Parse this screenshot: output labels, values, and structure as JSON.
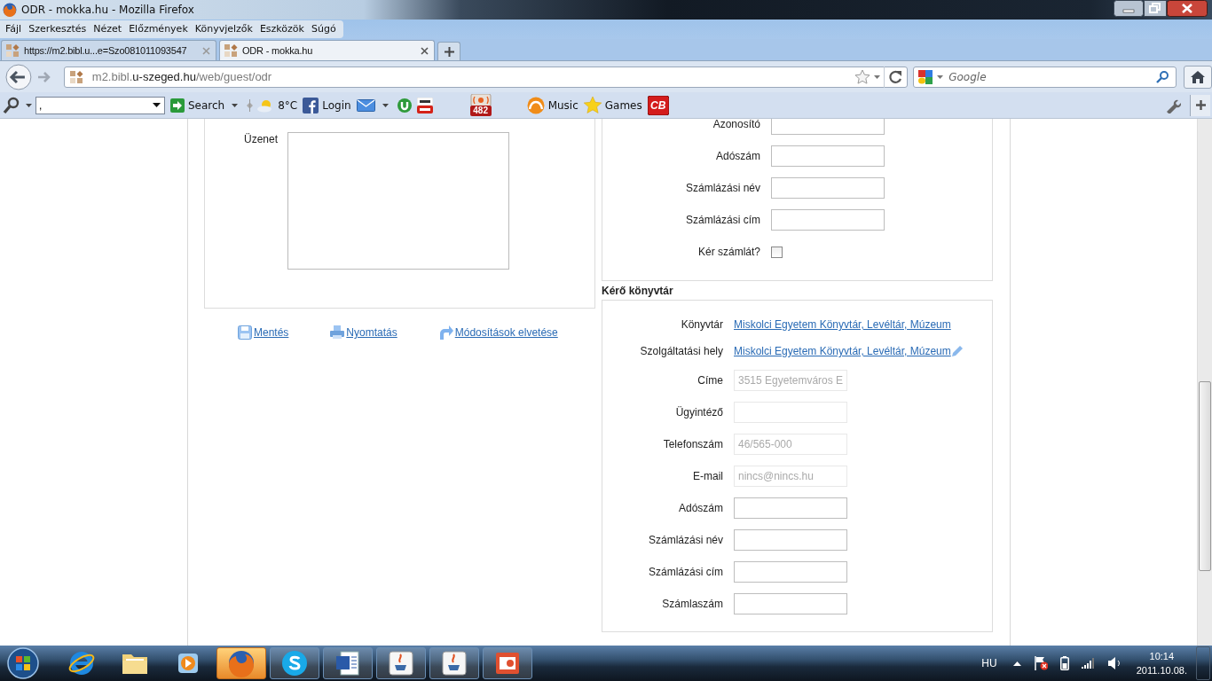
{
  "window": {
    "title": "ODR - mokka.hu - Mozilla Firefox"
  },
  "menu": [
    "Fájl",
    "Szerkesztés",
    "Nézet",
    "Előzmények",
    "Könyvjelzők",
    "Eszközök",
    "Súgó"
  ],
  "tabs": [
    {
      "label": "https://m2.bibl.u...e=Szo081011093547",
      "selected": false
    },
    {
      "label": "ODR - mokka.hu",
      "selected": true
    }
  ],
  "address": {
    "prefix": "m2.bibl.",
    "domain": "u-szeged.hu",
    "path": "/web/guest/odr"
  },
  "search": {
    "placeholder": "Google"
  },
  "bookmarks": {
    "search_value": ",",
    "items": [
      {
        "kind": "go",
        "label": "Search"
      },
      {
        "kind": "weather",
        "label": "8°C"
      },
      {
        "kind": "facebook",
        "label": "Login"
      },
      {
        "kind": "mail"
      },
      {
        "kind": "torrent"
      },
      {
        "kind": "youtube"
      },
      {
        "kind": "counter",
        "badge": "482"
      },
      {
        "kind": "music",
        "label": "Music"
      },
      {
        "kind": "games",
        "label": "Games"
      },
      {
        "kind": "cb",
        "badge": "CB"
      }
    ]
  },
  "message": {
    "label": "Üzenet"
  },
  "actions": [
    {
      "kind": "save",
      "label": "Mentés"
    },
    {
      "kind": "print",
      "label": "Nyomtatás"
    },
    {
      "kind": "undo",
      "label": "Módosítások elvetése"
    }
  ],
  "billing": {
    "fields": [
      {
        "label": "Azonosító",
        "disabled": false
      },
      {
        "label": "Adószám",
        "disabled": false
      },
      {
        "label": "Számlázási név",
        "disabled": false
      },
      {
        "label": "Számlázási cím",
        "disabled": false
      }
    ],
    "invoice": {
      "label": "Kér számlát?",
      "checked": false
    }
  },
  "library": {
    "title": "Kérő könyvtár",
    "links": [
      {
        "label": "Könyvtár",
        "value": "Miskolci Egyetem Könyvtár, Levéltár, Múzeum",
        "editable": false
      },
      {
        "label": "Szolgáltatási hely",
        "value": "Miskolci Egyetem Könyvtár, Levéltár, Múzeum",
        "editable": true
      }
    ],
    "fields": [
      {
        "label": "Címe",
        "value": "3515 Egyetemváros E",
        "disabled": true
      },
      {
        "label": "Ügyintéző",
        "disabled": true
      },
      {
        "label": "Telefonszám",
        "value": "46/565-000",
        "disabled": true
      },
      {
        "label": "E-mail",
        "value": "nincs@nincs.hu",
        "disabled": true
      },
      {
        "label": "Adószám",
        "disabled": false
      },
      {
        "label": "Számlázási név",
        "disabled": false
      },
      {
        "label": "Számlázási cím",
        "disabled": false
      },
      {
        "label": "Számlaszám",
        "disabled": false
      }
    ]
  },
  "taskbar": {
    "apps": [
      {
        "kind": "ie",
        "running": false,
        "selected": false
      },
      {
        "kind": "folder",
        "running": false,
        "selected": false
      },
      {
        "kind": "media",
        "running": false,
        "selected": false
      },
      {
        "kind": "firefox",
        "running": true,
        "selected": true
      },
      {
        "kind": "skype",
        "running": true,
        "selected": false
      },
      {
        "kind": "word",
        "running": true,
        "selected": false
      },
      {
        "kind": "java",
        "running": true,
        "selected": false
      },
      {
        "kind": "java",
        "running": true,
        "selected": false
      },
      {
        "kind": "powerpoint",
        "running": true,
        "selected": false
      }
    ],
    "language": "HU",
    "time": "10:14",
    "date": "2011.10.08."
  }
}
